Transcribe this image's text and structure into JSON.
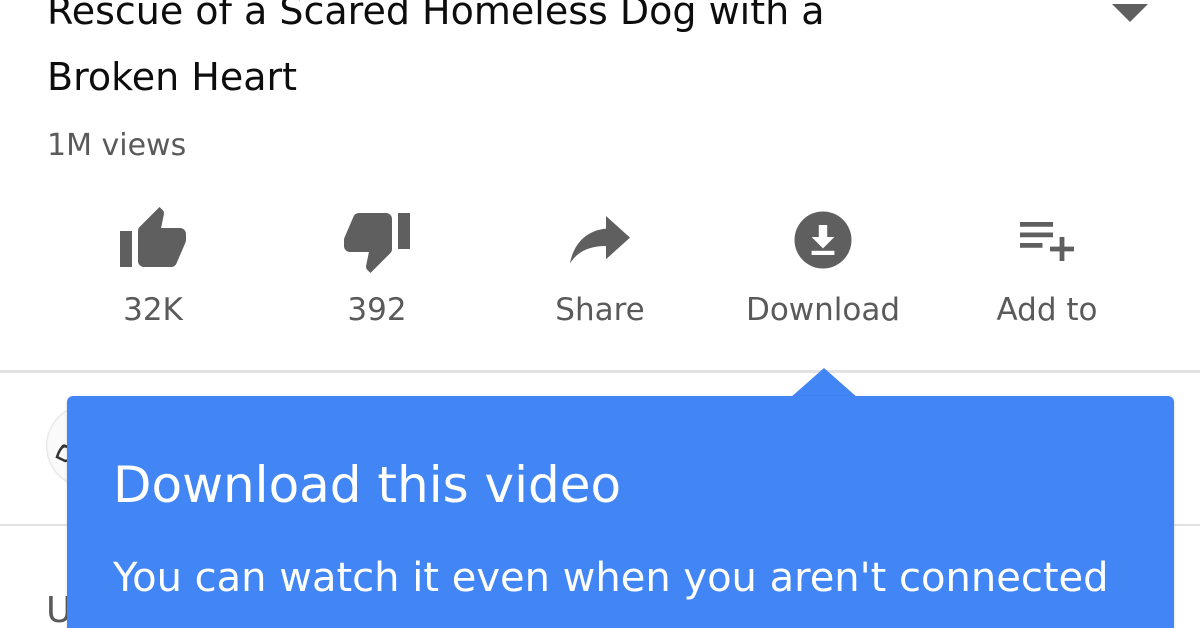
{
  "video": {
    "title_line1": "Rescue of a Scared Homeless Dog with a",
    "title_line2": "Broken Heart",
    "views": "1M views"
  },
  "actions": [
    {
      "icon": "thumbs-up-icon",
      "label": "32K"
    },
    {
      "icon": "thumbs-down-icon",
      "label": "392"
    },
    {
      "icon": "share-icon",
      "label": "Share"
    },
    {
      "icon": "download-icon",
      "label": "Download"
    },
    {
      "icon": "add-to-playlist-icon",
      "label": "Add to"
    }
  ],
  "tooltip": {
    "title": "Download this video",
    "body": "You can watch it even when you aren't connected"
  },
  "partial_text": "U",
  "colors": {
    "tooltip_bg": "#4285f4",
    "icon_gray": "#5f5f5f",
    "text_gray": "#5a5a5a"
  }
}
